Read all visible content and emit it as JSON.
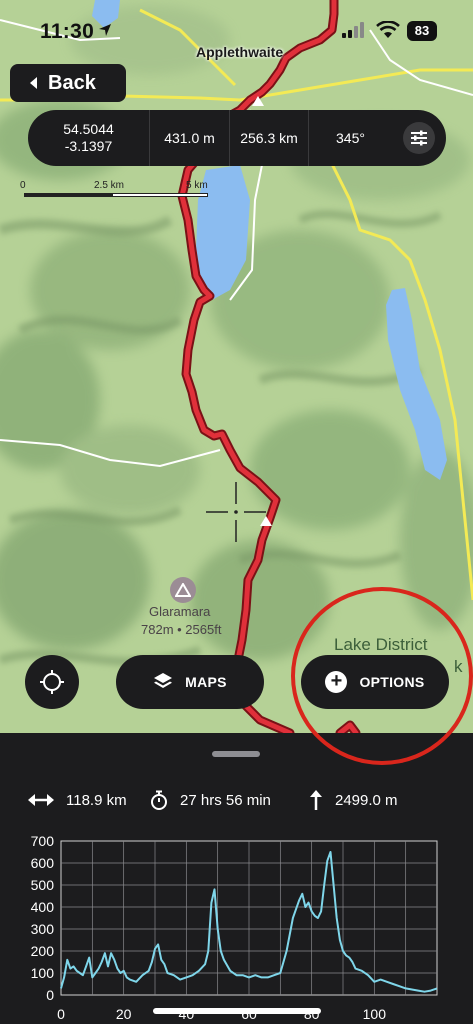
{
  "status_bar": {
    "time": "11:30",
    "battery": "83"
  },
  "back_button": {
    "label": "Back"
  },
  "map": {
    "places": {
      "town": "Applethwaite",
      "peak_name": "Glaramara",
      "peak_elevation": "782m • 2565ft",
      "park_line1": "Lake District",
      "park_line2": "k"
    },
    "scale": {
      "ticks": [
        "0",
        "2.5 km",
        "5 km"
      ]
    }
  },
  "info_bar": {
    "latitude": "54.5044",
    "longitude": "-3.1397",
    "elevation": "431.0 m",
    "distance": "256.3 km",
    "bearing": "345°"
  },
  "buttons": {
    "maps": "MAPS",
    "options": "OPTIONS"
  },
  "stats": {
    "distance": "118.9 km",
    "duration": "27 hrs 56 min",
    "ascent": "2499.0 m"
  },
  "colors": {
    "route": "#d3222a",
    "profile_line": "#7fd6ea",
    "highlight_ring": "#d9261c",
    "panel": "#1c1c1e"
  },
  "chart_data": {
    "type": "line",
    "title": "",
    "xlabel": "",
    "ylabel": "",
    "xlim": [
      0,
      120
    ],
    "ylim": [
      0,
      700
    ],
    "xticks": [
      0,
      20,
      40,
      60,
      80,
      100
    ],
    "yticks": [
      0,
      100,
      200,
      300,
      400,
      500,
      600,
      700
    ],
    "grid": true,
    "series": [
      {
        "x": [
          0,
          1,
          2,
          3,
          4,
          5,
          6,
          7,
          8,
          9,
          10,
          11,
          12,
          13,
          14,
          15,
          16,
          17,
          18,
          19,
          20,
          21,
          22,
          24,
          26,
          28,
          29,
          30,
          31,
          32,
          33,
          34,
          36,
          38,
          40,
          42,
          44,
          46,
          47,
          48,
          49,
          50,
          51,
          52,
          54,
          56,
          58,
          60,
          62,
          64,
          66,
          68,
          70,
          72,
          74,
          75,
          76,
          77,
          78,
          79,
          80,
          81,
          82,
          83,
          84,
          85,
          86,
          87,
          88,
          89,
          90,
          91,
          92,
          93,
          94,
          96,
          98,
          100,
          102,
          104,
          106,
          108,
          110,
          112,
          114,
          116,
          118,
          120
        ],
        "y": [
          30,
          80,
          160,
          120,
          130,
          110,
          100,
          90,
          130,
          170,
          80,
          100,
          120,
          150,
          190,
          130,
          190,
          160,
          120,
          100,
          110,
          80,
          70,
          60,
          90,
          110,
          150,
          210,
          230,
          160,
          140,
          100,
          90,
          70,
          80,
          90,
          110,
          140,
          200,
          420,
          480,
          300,
          200,
          160,
          110,
          90,
          90,
          80,
          90,
          80,
          80,
          90,
          100,
          200,
          350,
          390,
          430,
          460,
          400,
          420,
          380,
          360,
          350,
          380,
          500,
          610,
          650,
          500,
          350,
          250,
          200,
          180,
          170,
          150,
          120,
          110,
          90,
          60,
          70,
          60,
          50,
          40,
          30,
          25,
          20,
          15,
          20,
          30
        ]
      }
    ]
  }
}
